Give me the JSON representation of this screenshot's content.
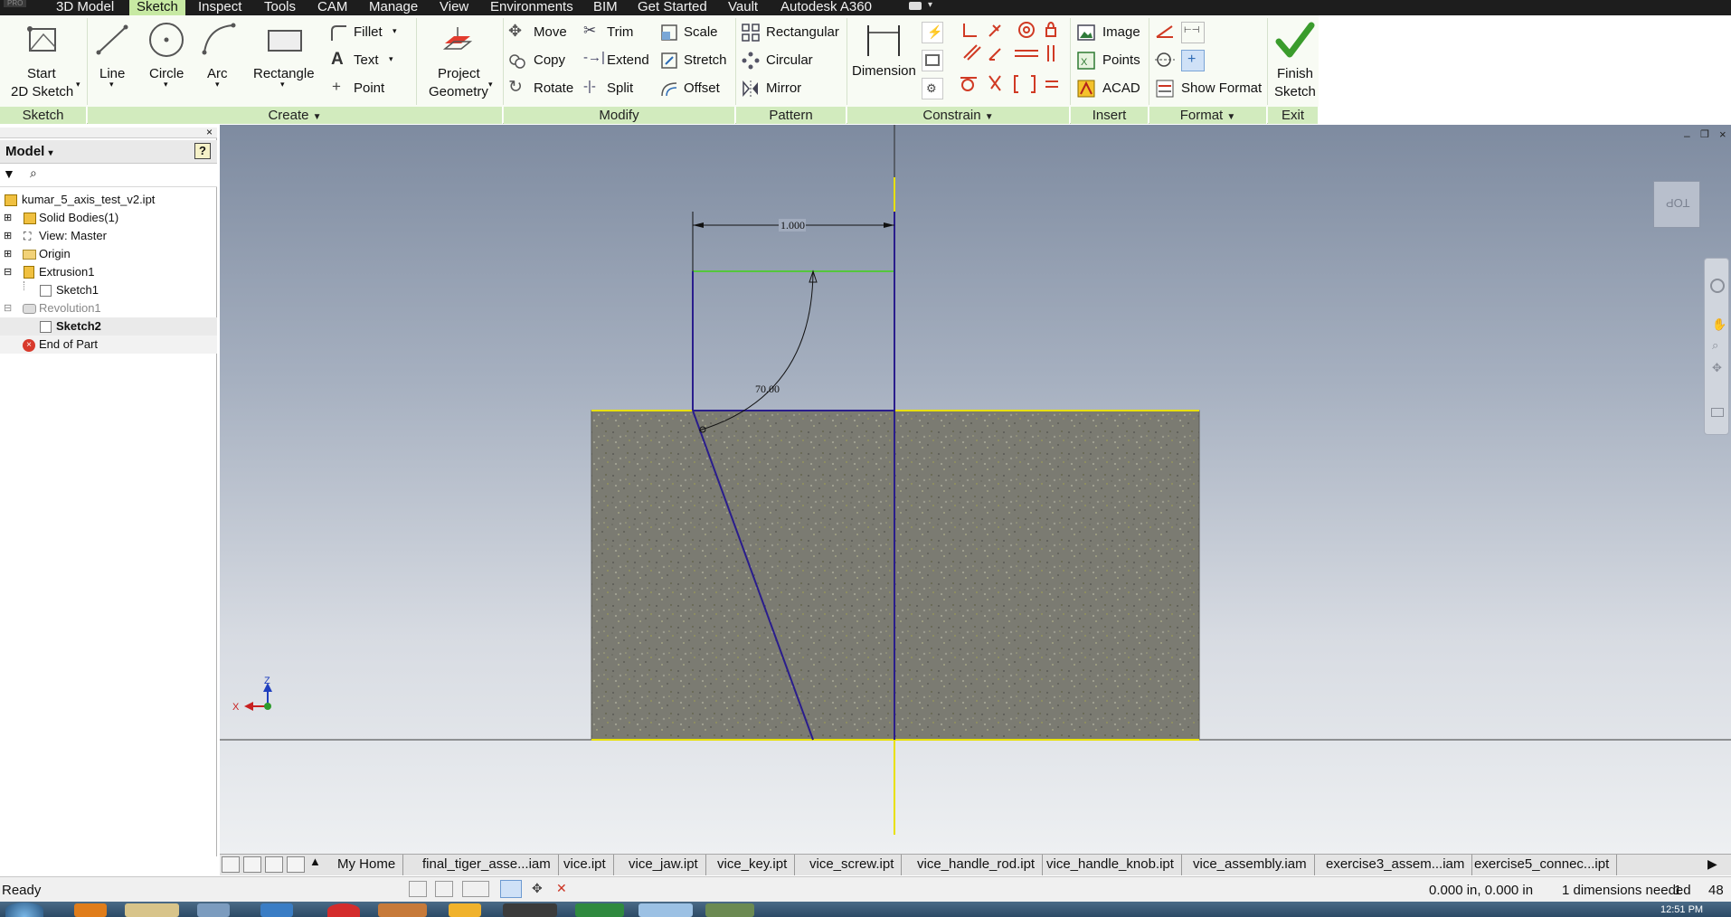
{
  "menu": {
    "pro": "PRO",
    "tabs": [
      "3D Model",
      "Sketch",
      "Inspect",
      "Tools",
      "CAM",
      "Manage",
      "View",
      "Environments",
      "BIM",
      "Get Started",
      "Vault",
      "Autodesk A360"
    ],
    "active": "Sketch"
  },
  "ribbon": {
    "start_2d_sketch": [
      "Start",
      "2D Sketch"
    ],
    "line": "Line",
    "circle": "Circle",
    "arc": "Arc",
    "rectangle": "Rectangle",
    "fillet": "Fillet",
    "text": "Text",
    "point": "Point",
    "project_geometry": [
      "Project",
      "Geometry"
    ],
    "move": "Move",
    "copy": "Copy",
    "rotate": "Rotate",
    "trim": "Trim",
    "extend": "Extend",
    "split": "Split",
    "scale": "Scale",
    "stretch": "Stretch",
    "offset": "Offset",
    "rectangular": "Rectangular",
    "circular": "Circular",
    "mirror": "Mirror",
    "dimension": "Dimension",
    "image": "Image",
    "points": "Points",
    "acad": "ACAD",
    "show_format": "Show Format",
    "finish_sketch": [
      "Finish",
      "Sketch"
    ],
    "panels": {
      "sketch": "Sketch",
      "create": "Create",
      "modify": "Modify",
      "pattern": "Pattern",
      "constrain": "Constrain",
      "insert": "Insert",
      "format": "Format",
      "exit": "Exit"
    }
  },
  "browser": {
    "title": "Model",
    "help": "?",
    "close": "×",
    "items": [
      {
        "label": "kumar_5_axis_test_v2.ipt",
        "icon": "part-icon"
      },
      {
        "label": "Solid Bodies(1)",
        "icon": "solid-bodies-icon"
      },
      {
        "label": "View: Master",
        "icon": "view-icon"
      },
      {
        "label": "Origin",
        "icon": "folder-icon"
      },
      {
        "label": "Extrusion1",
        "icon": "extrusion-icon"
      },
      {
        "label": "Sketch1",
        "icon": "sketch-icon"
      },
      {
        "label": "Revolution1",
        "icon": "revolution-icon"
      },
      {
        "label": "Sketch2",
        "icon": "sketch-icon"
      },
      {
        "label": "End of Part",
        "icon": "end-of-part-icon"
      }
    ]
  },
  "viewport": {
    "dimension_linear": "1.000",
    "dimension_angle": "70.00",
    "viewcube": "TOP",
    "axis_z": "Z",
    "axis_x": "X"
  },
  "doctabs": [
    "My Home",
    "final_tiger_asse...iam",
    "vice.ipt",
    "vice_jaw.ipt",
    "vice_key.ipt",
    "vice_screw.ipt",
    "vice_handle_rod.ipt",
    "vice_handle_knob.ipt",
    "vice_assembly.iam",
    "exercise3_assem...iam",
    "exercise5_connec...ipt"
  ],
  "status": {
    "left": "Ready",
    "coords": "0.000 in, 0.000 in",
    "dims": "1 dimensions needed",
    "num1": "1",
    "num2": "48",
    "clock": "12:51 PM"
  },
  "colors": {
    "ribbon_active": "#c7e9a3",
    "sketch_line": "#2a1d8c",
    "projected_line": "#e8e000",
    "constrained_line": "#54c63c",
    "part_face": "#7b7b72"
  }
}
